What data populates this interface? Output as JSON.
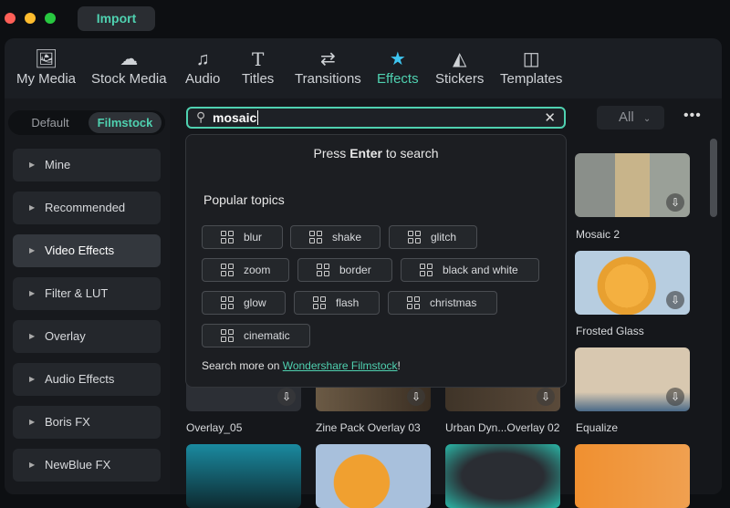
{
  "window": {
    "import_label": "Import"
  },
  "nav": [
    {
      "label": "My Media",
      "icon": "image-icon"
    },
    {
      "label": "Stock Media",
      "icon": "cloud-folder-icon"
    },
    {
      "label": "Audio",
      "icon": "music-note-icon"
    },
    {
      "label": "Titles",
      "icon": "text-t-icon"
    },
    {
      "label": "Transitions",
      "icon": "transition-icon"
    },
    {
      "label": "Effects",
      "icon": "star-wand-icon",
      "active": true
    },
    {
      "label": "Stickers",
      "icon": "sticker-icon"
    },
    {
      "label": "Templates",
      "icon": "layout-icon"
    }
  ],
  "toggle": {
    "default": "Default",
    "filmstock": "Filmstock",
    "selected": "Filmstock"
  },
  "sidebar": [
    "Mine",
    "Recommended",
    "Video Effects",
    "Filter & LUT",
    "Overlay",
    "Audio Effects",
    "Boris FX",
    "NewBlue FX"
  ],
  "sidebar_active": "Video Effects",
  "search": {
    "value": "mosaic"
  },
  "filter": {
    "value": "All"
  },
  "dropdown": {
    "press_pre": "Press ",
    "press_key": "Enter",
    "press_post": " to search",
    "popular_title": "Popular topics",
    "topics": [
      "blur",
      "shake",
      "glitch",
      "zoom",
      "border",
      "black and white",
      "glow",
      "flash",
      "christmas",
      "cinematic"
    ],
    "more_pre": "Search more on ",
    "more_link": "Wondershare Filmstock",
    "more_post": "!"
  },
  "cards": [
    "Mosaic 2",
    "Frosted Glass",
    "Overlay_05",
    "Zine Pack Overlay 03",
    "Urban Dyn...Overlay 02",
    "Equalize"
  ],
  "colors": {
    "accent": "#4fd1b0",
    "bg": "#1b1e23"
  }
}
